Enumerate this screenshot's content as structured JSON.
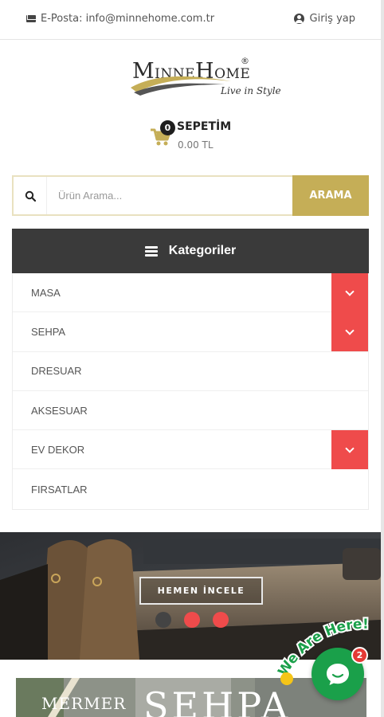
{
  "topbar": {
    "email": "E-Posta: info@minnehome.com.tr",
    "login": "Giriş yap"
  },
  "logo": {
    "brand_m": "M",
    "brand_inne": "INNE",
    "brand_h": "H",
    "brand_ome": "OME",
    "registered": "®",
    "tagline": "Live in Style"
  },
  "cart": {
    "count": "0",
    "title": "SEPETİM",
    "total": "0.00 TL"
  },
  "search": {
    "placeholder": "Ürün Arama...",
    "value": "",
    "button": "ARAMA"
  },
  "categories": {
    "title": "Kategoriler",
    "items": [
      {
        "label": "MASA",
        "has_children": true
      },
      {
        "label": "SEHPA",
        "has_children": true
      },
      {
        "label": "DRESUAR",
        "has_children": false
      },
      {
        "label": "AKSESUAR",
        "has_children": false
      },
      {
        "label": "EV DEKOR",
        "has_children": true
      },
      {
        "label": "FIRSATLAR",
        "has_children": false
      }
    ]
  },
  "slider": {
    "button": "HEMEN İNCELE",
    "dots": 3,
    "active_dot_count": 2
  },
  "banner": {
    "line1": "MERMER",
    "line2": "SEHPA"
  },
  "chat": {
    "label": "We Are Here!",
    "badge": "2"
  },
  "colors": {
    "accent_gold": "#c5ae57",
    "category_header": "#3a3a3a",
    "toggle_red": "#ef4b4b",
    "chat_green": "#1aa04a"
  }
}
